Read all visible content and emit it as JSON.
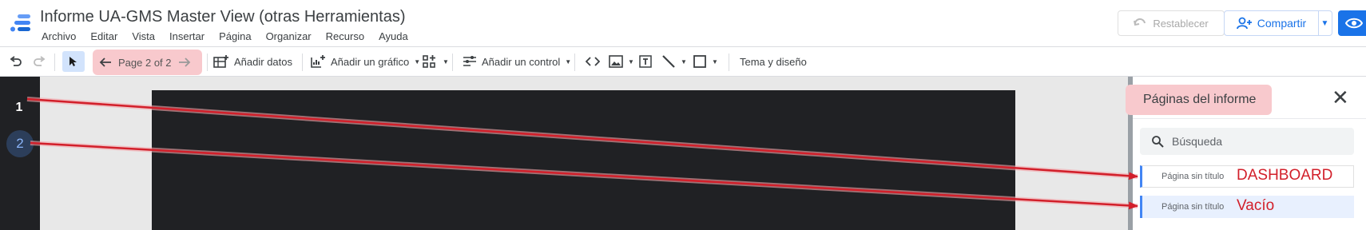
{
  "app": {
    "title": "Informe UA-GMS Master View (otras Herramientas)",
    "menu": [
      "Archivo",
      "Editar",
      "Vista",
      "Insertar",
      "Página",
      "Organizar",
      "Recurso",
      "Ayuda"
    ]
  },
  "header": {
    "restore_label": "Restablecer",
    "share_label": "Compartir"
  },
  "toolbar": {
    "page_indicator": "Page 2 of 2",
    "add_data_label": "Añadir datos",
    "add_chart_label": "Añadir un gráfico",
    "add_control_label": "Añadir un control",
    "theme_label": "Tema y diseño"
  },
  "page_nav": {
    "pages": [
      "1",
      "2"
    ],
    "active": "2"
  },
  "panel": {
    "title": "Páginas del informe",
    "search_placeholder": "Búsqueda",
    "pages": [
      {
        "name": "Página sin título",
        "annotation": "DASHBOARD"
      },
      {
        "name": "Página sin título",
        "annotation": "Vacío"
      }
    ]
  },
  "colors": {
    "accent": "#1a73e8",
    "highlight": "#f8c9cd",
    "annotation": "#d21f2a",
    "canvas_dark": "#202124"
  }
}
